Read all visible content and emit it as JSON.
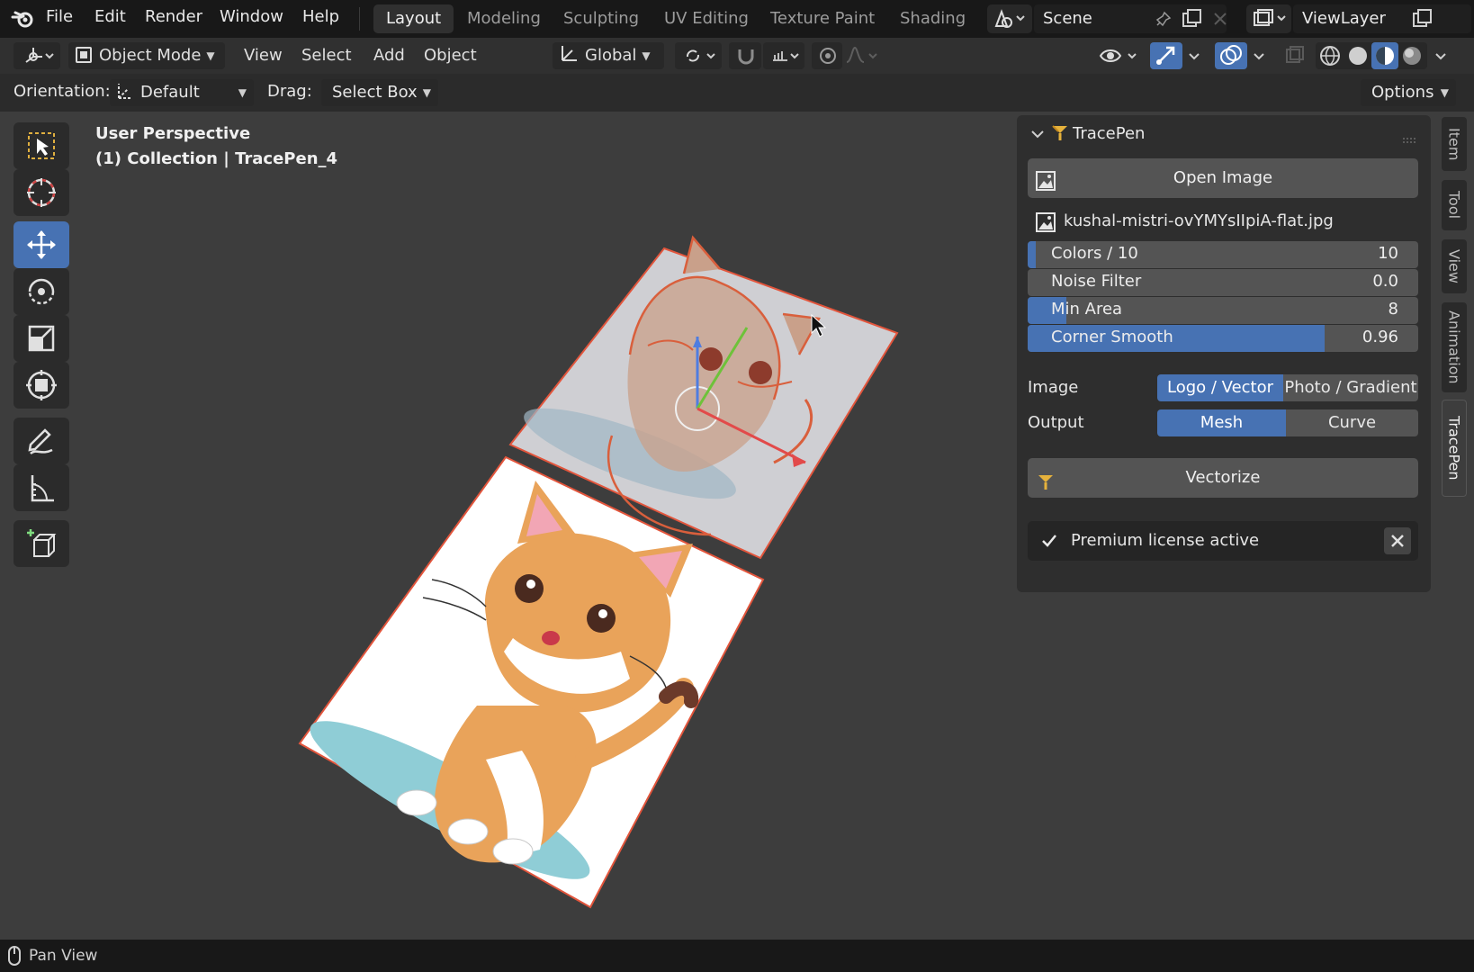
{
  "menu": {
    "items": [
      "File",
      "Edit",
      "Render",
      "Window",
      "Help"
    ]
  },
  "workspaces": [
    "Layout",
    "Modeling",
    "Sculpting",
    "UV Editing",
    "Texture Paint",
    "Shading"
  ],
  "scene": {
    "name": "Scene"
  },
  "view_layer": {
    "name": "ViewLayer"
  },
  "header": {
    "mode": "Object Mode",
    "view": "View",
    "select": "Select",
    "add": "Add",
    "object": "Object",
    "transform_orientation": "Global"
  },
  "tool_settings": {
    "orientation_label": "Orientation:",
    "orientation_value": "Default",
    "drag_label": "Drag:",
    "drag_value": "Select Box",
    "options": "Options"
  },
  "viewport": {
    "line1": "User Perspective",
    "line2": "(1) Collection | TracePen_4"
  },
  "panel": {
    "title": "TracePen",
    "open_image": "Open Image",
    "filename": "kushal-mistri-ovYMYsIIpiA-flat.jpg",
    "sliders": [
      {
        "label": "Colors / 10",
        "value": "10",
        "fill": 0.02
      },
      {
        "label": "Noise Filter",
        "value": "0.0",
        "fill": 0.0
      },
      {
        "label": "Min Area",
        "value": "8",
        "fill": 0.1
      },
      {
        "label": "Corner Smooth",
        "value": "0.96",
        "fill": 0.76
      }
    ],
    "image_label": "Image",
    "image_options": [
      "Logo / Vector",
      "Photo / Gradient"
    ],
    "image_selected": "Logo / Vector",
    "output_label": "Output",
    "output_options": [
      "Mesh",
      "Curve"
    ],
    "output_selected": "Mesh",
    "vectorize": "Vectorize",
    "license": "Premium license active"
  },
  "side_tabs": [
    "Item",
    "Tool",
    "View",
    "Animation",
    "TracePen"
  ],
  "side_tab_active": "TracePen",
  "status": {
    "text": "Pan View"
  },
  "colors": {
    "accent": "#4772b3",
    "selection_outline": "#e2553c"
  }
}
